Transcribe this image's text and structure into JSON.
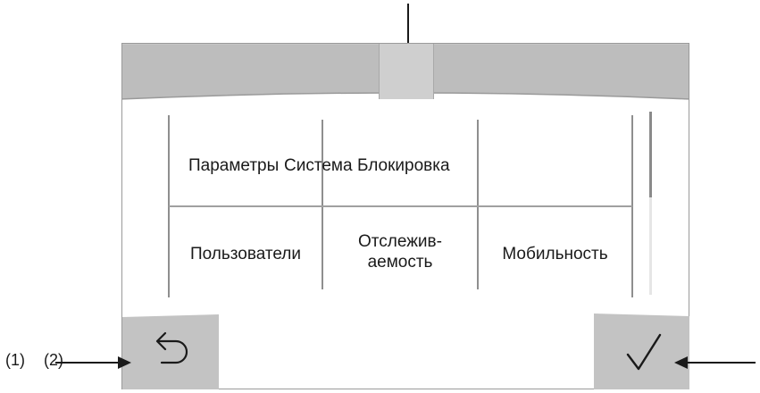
{
  "menu": {
    "row1": [
      "Параметры",
      "Система",
      "Блокировка"
    ],
    "row2": {
      "col1": "Пользователи",
      "col2_line1": "Отслежив-",
      "col2_line2": "аемость",
      "col3": "Мобильность"
    }
  },
  "buttons": {
    "back_icon": "undo-arrow-icon",
    "confirm_icon": "checkmark-icon"
  },
  "callouts": {
    "left_label_1": "(1)",
    "left_label_2": "(2)"
  },
  "scrollbar": {
    "thumb_fraction": 0.47
  },
  "colors": {
    "bar_gray": "#bdbdbd",
    "button_gray": "#c3c3c3",
    "line_gray": "#8f8f8f"
  }
}
